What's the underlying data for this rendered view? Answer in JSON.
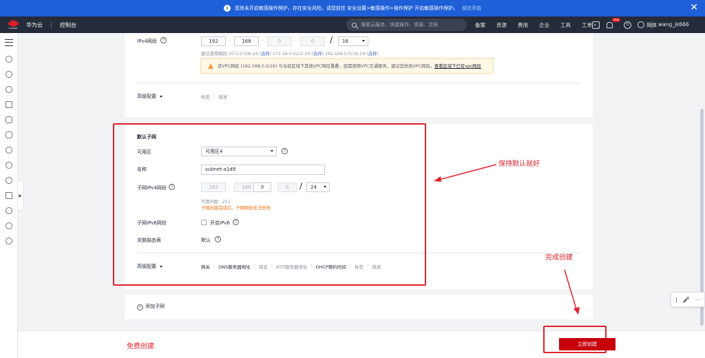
{
  "notice": {
    "text": "您尚未开启敏感操作保护，存在安全风险。请您前往 安全设置>敏感操作>操作保护 开启敏感操作保护。",
    "link": "前往开启"
  },
  "topnav": {
    "logo_text": "HUAWEI",
    "brand": "华为云",
    "console": "控制台",
    "search_placeholder": "搜索云服务、快捷操作、资源、文档",
    "links": [
      "备案",
      "资源",
      "费用",
      "企业",
      "工具",
      "工单"
    ],
    "badge": "new",
    "language": "简体",
    "user": "wang_jk666"
  },
  "vpc": {
    "ipv4_label": "IPv4网段",
    "cidr": [
      "192",
      "168",
      "0",
      "0"
    ],
    "mask": "16",
    "hint_prefix": "建议使用网段:10.0.0.0/8-24 (",
    "select_label": "选择",
    "hint_mid1": ") 172.16.0.0/12-24 (",
    "hint_mid2": ") 192.168.0.0/16-24 (",
    "hint_end": ")",
    "warning_text": "该VPC网段 (192.168.0.0/16) 与当前区域下其他VPC网段重叠，如需使用VPC互通服务，建议您修改VPC网段。",
    "warning_link": "查看区域下已有vpc网段",
    "advanced_label": "高级配置",
    "advanced_tabs": [
      "标签",
      "描述"
    ]
  },
  "subnet": {
    "title": "默认子网",
    "az_label": "可用区",
    "az_value": "可用区4",
    "name_label": "名称",
    "name_value": "subnet-a1d9",
    "ipv4_label": "子网IPv4网段",
    "cidr": [
      "192",
      "168",
      "0",
      "0"
    ],
    "mask": "24",
    "available_ip": "可用IP数：251",
    "cidr_warning": "子网创建完成后，子网网段无法修改",
    "ipv6_label": "子网IPv6网段",
    "ipv6_checkbox": "开启IPv6",
    "route_label": "关联路由表",
    "route_value": "默认",
    "advanced_label": "高级配置",
    "advanced_tabs": [
      "网关",
      "DNS服务器地址",
      "域名",
      "NTP服务器地址",
      "DHCP租约时间",
      "标签",
      "描述"
    ]
  },
  "add_subnet": "添加子网",
  "annotations": {
    "keep_default": "保持默认就好",
    "finish_create": "完成创建",
    "free_create": "免费创建"
  },
  "create_button": "立即创建",
  "colors": {
    "primary_blue": "#1f5fd8",
    "nav_dark": "#252b3a",
    "huawei_red": "#c7000b",
    "annotation_red": "#e0202a",
    "warning_orange": "#f66f0e"
  }
}
